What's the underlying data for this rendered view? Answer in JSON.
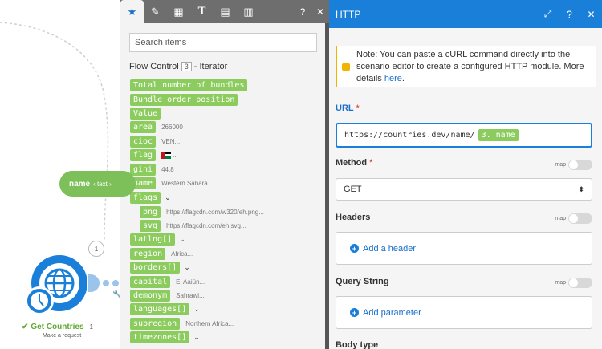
{
  "canvas": {
    "name_chip": {
      "label": "name",
      "type": "‹ text ›"
    },
    "bubble_count": "1",
    "module": {
      "title": "Get Countries",
      "number": "1",
      "subtitle": "Make a request"
    }
  },
  "mapping": {
    "search_placeholder": "Search items",
    "group": {
      "title": "Flow Control",
      "number": "3",
      "suffix": "- Iterator"
    },
    "items": [
      {
        "label": "Total number of bundles",
        "value": ""
      },
      {
        "label": "Bundle order position",
        "value": ""
      },
      {
        "label": "Value",
        "value": ""
      },
      {
        "label": "area",
        "value": "266000"
      },
      {
        "label": "cioc",
        "value": "VEN..."
      },
      {
        "label": "flag",
        "value": "..."
      },
      {
        "label": "gini",
        "value": "44.8"
      },
      {
        "label": "name",
        "value": "Western Sahara..."
      },
      {
        "label": "flags",
        "value": ""
      },
      {
        "label": "png",
        "value": "https://flagcdn.com/w320/eh.png..."
      },
      {
        "label": "svg",
        "value": "https://flagcdn.com/eh.svg..."
      },
      {
        "label": "latlng[]",
        "value": ""
      },
      {
        "label": "region",
        "value": "Africa..."
      },
      {
        "label": "borders[]",
        "value": ""
      },
      {
        "label": "capital",
        "value": "El Aaiún..."
      },
      {
        "label": "demonym",
        "value": "Sahrawi..."
      },
      {
        "label": "languages[]",
        "value": ""
      },
      {
        "label": "subregion",
        "value": "Northern Africa..."
      },
      {
        "label": "timezones[]",
        "value": ""
      }
    ]
  },
  "http": {
    "title": "HTTP",
    "note": {
      "text": "Note: You can paste a cURL command directly into the scenario editor to create a configured HTTP module. More details ",
      "link": "here",
      "end": "."
    },
    "url": {
      "label": "URL",
      "required": "*",
      "value": "https://countries.dev/name/",
      "chip": "3. name"
    },
    "method": {
      "label": "Method",
      "required": "*",
      "value": "GET"
    },
    "map_label": "map",
    "headers": {
      "label": "Headers",
      "button": "Add a header"
    },
    "query": {
      "label": "Query String",
      "button": "Add parameter"
    },
    "body_label": "Body type"
  },
  "colors": {
    "accent": "#1a7fd8",
    "chip": "#8ccc5f",
    "module_green": "#7dc05a",
    "note": "#f0b400"
  }
}
